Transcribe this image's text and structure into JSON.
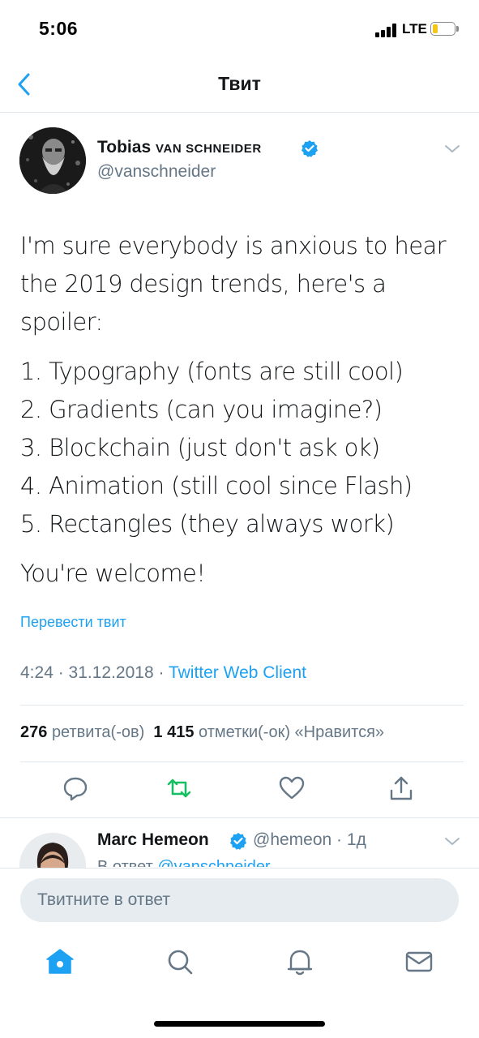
{
  "status_bar": {
    "time": "5:06",
    "network": "LTE",
    "battery_level": 0.25
  },
  "nav": {
    "title": "Твит"
  },
  "tweet": {
    "author_name_first": "Tobias ",
    "author_name_rest": "VAN SCHNEIDER",
    "handle": "@vanschneider",
    "text_intro": "I'm sure everybody is anxious to hear the 2019 design trends, here's a spoiler:",
    "list_items": [
      "1. Typography (fonts are still cool)",
      "2. Gradients (can you imagine?)",
      "3. Blockchain (just don't ask ok)",
      "4. Animation (still cool since Flash)",
      "5. Rectangles (they always work)"
    ],
    "closing": "You're welcome!",
    "translate_label": "Перевести твит",
    "time": "4:24",
    "date": "31.12.2018",
    "separator": " · ",
    "client": "Twitter Web Client",
    "retweets_count": "276",
    "retweets_label": "ретвита(-ов)",
    "likes_count": "1 415",
    "likes_label": "отметки(-ок) «Нравится»"
  },
  "reply": {
    "name": "Marc Hemeon",
    "handle": "@hemeon",
    "age": "1д",
    "reply_prefix": "В ответ ",
    "reply_user": "@vanschneider"
  },
  "compose": {
    "placeholder": "Твитните в ответ"
  },
  "colors": {
    "accent": "#1da1f2",
    "retweet": "#17bf63",
    "text": "#14171a",
    "secondary": "#657786"
  }
}
